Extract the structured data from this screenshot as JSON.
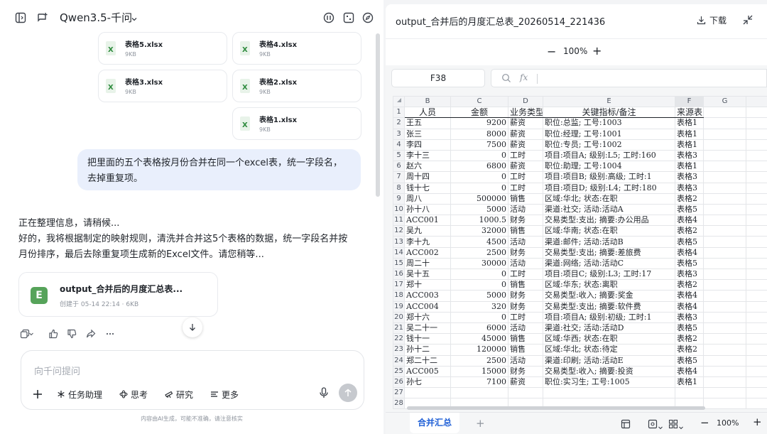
{
  "topbar": {
    "model_name": "Qwen3.5-千问"
  },
  "attachments": [
    {
      "name": "表格5.xlsx",
      "size": "9KB"
    },
    {
      "name": "表格4.xlsx",
      "size": "9KB"
    },
    {
      "name": "表格3.xlsx",
      "size": "9KB"
    },
    {
      "name": "表格2.xlsx",
      "size": "9KB"
    },
    {
      "name": "表格1.xlsx",
      "size": "9KB"
    }
  ],
  "user_message": {
    "line1": "把里面的五个表格按月份合并在同一个excel表，统一字段名，",
    "line2": "去掉重复项。"
  },
  "assistant_message": {
    "line1": "正在整理信息，请稍候...",
    "line2": "好的，我将根据制定的映射规则，清洗并合并这5个表格的数据，统一字段名并按",
    "line3": "月份排序，最后去除重复项生成新的Excel文件。请您稍等..."
  },
  "output_file": {
    "icon_letter": "E",
    "title": "output_合并后的月度汇总表...",
    "meta": "创建于 05-14 22:14 · 6KB"
  },
  "input": {
    "placeholder": "向千问提问",
    "tools": [
      "任务助理",
      "思考",
      "研究",
      "更多"
    ]
  },
  "disclaimer": "内容由AI生成，可能不准确，请注意核实",
  "viewer": {
    "title": "output_合并后的月度汇总表_20260514_221436",
    "download_label": "下载",
    "zoom": "100%",
    "namebox": "F38",
    "fx": "fx",
    "sheet_tab": "合并汇总",
    "bottom_zoom": "100%"
  },
  "sheet": {
    "columns": [
      "B",
      "C",
      "D",
      "E",
      "F",
      "G"
    ],
    "header_row": [
      "人员",
      "金额",
      "业务类型",
      "关键指标/备注",
      "来源表"
    ],
    "rows": [
      [
        "王五",
        "9200",
        "薪资",
        "职位:总监; 工号:1003",
        "表格1"
      ],
      [
        "张三",
        "8000",
        "薪资",
        "职位:经理; 工号:1001",
        "表格1"
      ],
      [
        "李四",
        "7500",
        "薪资",
        "职位:专员; 工号:1002",
        "表格1"
      ],
      [
        "李十三",
        "0",
        "工时",
        "项目:项目A; 级别:L5; 工时:160",
        "表格3"
      ],
      [
        "赵六",
        "6800",
        "薪资",
        "职位:助理; 工号:1004",
        "表格1"
      ],
      [
        "周十四",
        "0",
        "工时",
        "项目:项目B; 级别:高级; 工时:1",
        "表格3"
      ],
      [
        "钱十七",
        "0",
        "工时",
        "项目:项目D; 级别:L4; 工时:180",
        "表格3"
      ],
      [
        "周八",
        "500000",
        "销售",
        "区域:华北; 状态:在职",
        "表格2"
      ],
      [
        "孙十八",
        "5000",
        "活动",
        "渠道:社交; 活动:活动A",
        "表格5"
      ],
      [
        "ACC001",
        "1000.5",
        "财务",
        "交易类型:支出; 摘要:办公用品",
        "表格4"
      ],
      [
        "吴九",
        "32000",
        "销售",
        "区域:华南; 状态:在职",
        "表格2"
      ],
      [
        "李十九",
        "4500",
        "活动",
        "渠道:邮件; 活动:活动B",
        "表格5"
      ],
      [
        "ACC002",
        "2500",
        "财务",
        "交易类型:支出; 摘要:差旅费",
        "表格4"
      ],
      [
        "周二十",
        "30000",
        "活动",
        "渠道:网络; 活动:活动C",
        "表格5"
      ],
      [
        "吴十五",
        "0",
        "工时",
        "项目:项目C; 级别:L3; 工时:17",
        "表格3"
      ],
      [
        "郑十",
        "0",
        "销售",
        "区域:华东; 状态:离职",
        "表格2"
      ],
      [
        "ACC003",
        "5000",
        "财务",
        "交易类型:收入; 摘要:奖金",
        "表格4"
      ],
      [
        "ACC004",
        "320",
        "财务",
        "交易类型:支出; 摘要:软件费",
        "表格4"
      ],
      [
        "郑十六",
        "0",
        "工时",
        "项目:项目A; 级别:初级; 工时:1",
        "表格3"
      ],
      [
        "吴二十一",
        "6000",
        "活动",
        "渠道:社交; 活动:活动D",
        "表格5"
      ],
      [
        "钱十一",
        "45000",
        "销售",
        "区域:华西; 状态:在职",
        "表格2"
      ],
      [
        "孙十二",
        "120000",
        "销售",
        "区域:华北; 状态:待定",
        "表格2"
      ],
      [
        "郑二十二",
        "2500",
        "活动",
        "渠道:印刷; 活动:活动E",
        "表格5"
      ],
      [
        "ACC005",
        "15000",
        "财务",
        "交易类型:收入; 摘要:投资",
        "表格4"
      ],
      [
        "孙七",
        "7100",
        "薪资",
        "职位:实习生; 工号:1005",
        "表格1"
      ]
    ],
    "row_numbers": [
      "1",
      "2",
      "3",
      "4",
      "5",
      "6",
      "7",
      "8",
      "9",
      "10",
      "11",
      "12",
      "13",
      "14",
      "15",
      "16",
      "17",
      "18",
      "19",
      "20",
      "21",
      "22",
      "23",
      "24",
      "25",
      "26",
      "27",
      "28"
    ]
  }
}
